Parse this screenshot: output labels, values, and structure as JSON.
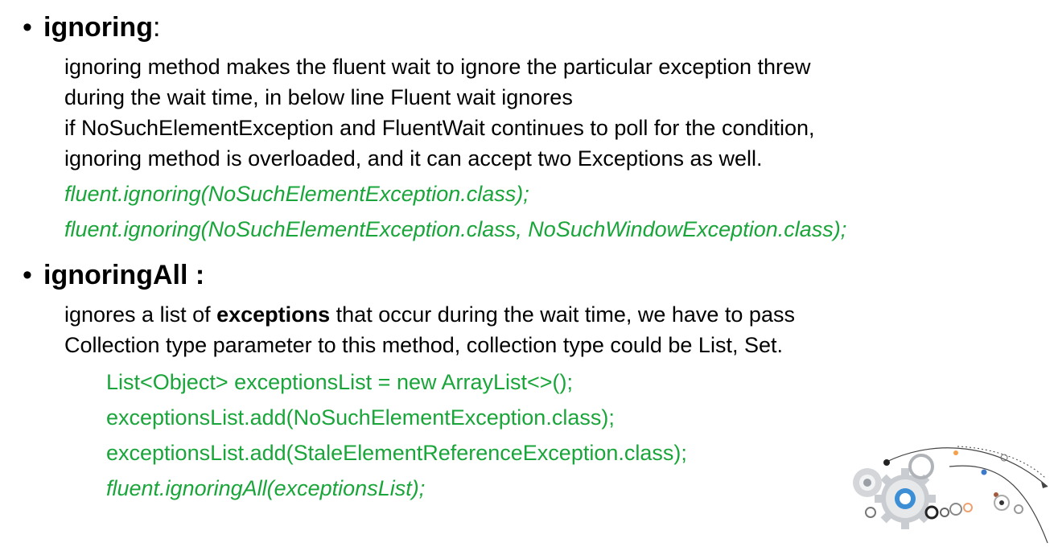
{
  "sections": [
    {
      "bullet": "•",
      "term": "ignoring",
      "term_suffix": ":",
      "description_lines": [
        "ignoring method makes the fluent wait to ignore the particular exception threw",
        "during the wait time, in below line Fluent wait ignores",
        "if NoSuchElementException and FluentWait continues to poll for the condition,",
        "ignoring method is overloaded, and it can accept two Exceptions as well."
      ],
      "code_lines": [
        "fluent.ignoring(NoSuchElementException.class);",
        "fluent.ignoring(NoSuchElementException.class, NoSuchWindowException.class);"
      ]
    },
    {
      "bullet": "•",
      "term": "ignoringAll :",
      "description_line1_before": "ignores a list of ",
      "description_line1_bold": "exceptions",
      "description_line1_after": " that occur during the wait time, we have to pass",
      "description_line2": "Collection type parameter to this method, collection type could be List, Set.",
      "code_lines": [
        "List<Object> exceptionsList = new ArrayList<>();",
        "exceptionsList.add(NoSuchElementException.class);",
        "exceptionsList.add(StaleElementReferenceException.class);",
        "fluent.ignoringAll(exceptionsList);"
      ]
    }
  ],
  "colors": {
    "code": "#1aa53a",
    "text": "#000000",
    "background": "#ffffff"
  },
  "decoration": {
    "icon": "gears-network-icon"
  }
}
